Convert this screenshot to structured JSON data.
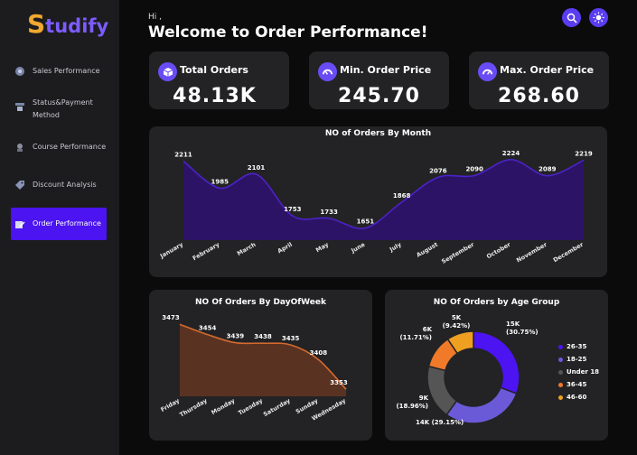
{
  "app": {
    "logo_first": "S",
    "logo_rest": "tudify"
  },
  "sidebar": {
    "items": [
      {
        "label": "Sales Performance",
        "icon": "sales-icon"
      },
      {
        "label": "Status&Payment Method",
        "icon": "payment-icon"
      },
      {
        "label": "Course Performance",
        "icon": "course-icon"
      },
      {
        "label": "Discount Analysis",
        "icon": "discount-icon"
      },
      {
        "label": "Order Performance",
        "icon": "order-icon",
        "active": true
      }
    ]
  },
  "header": {
    "hi": "Hi ,",
    "title": "Welcome to Order Performance!"
  },
  "kpis": [
    {
      "label": "Total Orders",
      "value": "48.13K",
      "icon": "cube-icon"
    },
    {
      "label": "Min. Order Price",
      "value": "245.70",
      "icon": "gauge-low-icon"
    },
    {
      "label": "Max. Order Price",
      "value": "268.60",
      "icon": "gauge-high-icon"
    }
  ],
  "colors": {
    "accent": "#4b14f0",
    "monthFill": "#2d1366",
    "monthLine": "#4b22c8",
    "dayFill": "#5a3222",
    "dayLine": "#d66a2e"
  },
  "chart_data": [
    {
      "type": "area",
      "title": "NO of Orders By Month",
      "categories": [
        "January",
        "February",
        "March",
        "April",
        "May",
        "June",
        "July",
        "August",
        "September",
        "October",
        "November",
        "December"
      ],
      "values": [
        2211,
        1985,
        2101,
        1753,
        1733,
        1651,
        1868,
        2076,
        2090,
        2224,
        2089,
        2219
      ],
      "labels": [
        "2211",
        "1985",
        "2101",
        "1753",
        "1733",
        "1651",
        "1868",
        "2076",
        "2090",
        "2224",
        "2089",
        "2219"
      ],
      "ylim": [
        1550,
        2260
      ]
    },
    {
      "type": "area",
      "title": "NO Of Orders By DayOfWeek",
      "categories": [
        "Friday",
        "Thursday",
        "Monday",
        "Tuesday",
        "Saturday",
        "Sunday",
        "Wednesday"
      ],
      "values": [
        3473,
        3454,
        3439,
        3438,
        3435,
        3408,
        3353
      ],
      "labels": [
        "3473",
        "3454",
        "3439",
        "3438",
        "3435",
        "3408",
        "3353"
      ],
      "ylim": [
        3340,
        3480
      ]
    },
    {
      "type": "pie",
      "title": "NO Of Orders by Age Group",
      "categories": [
        "26-35",
        "18-25",
        "Under 18",
        "36-45",
        "46-60"
      ],
      "values": [
        30.75,
        29.15,
        18.96,
        11.71,
        9.42
      ],
      "labels": [
        [
          "15K",
          "(30.75%)"
        ],
        [
          "14K (29.15%)"
        ],
        [
          "9K",
          "(18.96%)"
        ],
        [
          "6K",
          "(11.71%)"
        ],
        [
          "5K",
          "(9.42%)"
        ]
      ],
      "colors": [
        "#4b14f0",
        "#6a5ad8",
        "#555555",
        "#f07a2a",
        "#f0a020"
      ]
    }
  ]
}
